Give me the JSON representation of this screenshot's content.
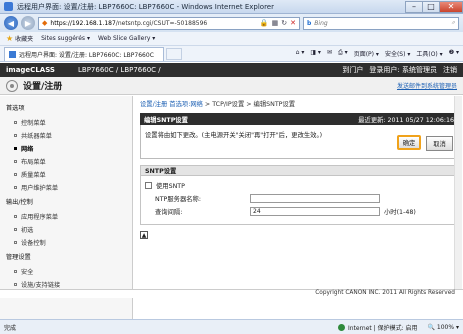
{
  "window": {
    "title": "远程用户界面: 设置/注册: LBP7660C: LBP7660C - Windows Internet Explorer",
    "minimize": "–",
    "maximize": "□",
    "close": "✕"
  },
  "address": {
    "url_host": "https://192.168.1.187",
    "url_path": "/netsntp.cgi/CSUT=-50188596",
    "search_engine": "Bing",
    "search_placeholder": "Bing",
    "back_icon": "◀",
    "forward_icon": "▶"
  },
  "favorites": {
    "label": "收藏夹",
    "items": [
      "Sites suggérés ▾",
      "Web Slice Gallery ▾"
    ]
  },
  "tab": {
    "label": "远程用户界面: 设置/注册: LBP7660C: LBP7660C"
  },
  "commands": {
    "page": "页面(P) ▾",
    "safety": "安全(S) ▾",
    "tools": "工具(O) ▾",
    "help": "❷ ▾"
  },
  "header": {
    "brand": "imageCLASS",
    "model": "LBP7660C / LBP7660C /",
    "links": [
      "到门户",
      "登录用户: 系统管理员",
      "注销"
    ],
    "title": "设置/注册",
    "mail_link": "发送邮件到系统管理员"
  },
  "sidebar": {
    "groups": [
      {
        "label": "首选项",
        "items": [
          {
            "label": "控制菜单",
            "active": false
          },
          {
            "label": "共纸器菜单",
            "active": false
          },
          {
            "label": "网络",
            "active": true
          },
          {
            "label": "布局菜单",
            "active": false
          },
          {
            "label": "质量菜单",
            "active": false
          },
          {
            "label": "用户维护菜单",
            "active": false
          }
        ]
      },
      {
        "label": "输出/控制",
        "items": [
          {
            "label": "应用程序菜单",
            "active": false
          },
          {
            "label": "初选",
            "active": false
          },
          {
            "label": "设备控制",
            "active": false
          }
        ]
      },
      {
        "label": "管理设置",
        "items": [
          {
            "label": "安全",
            "active": false
          },
          {
            "label": "设施/支持链接",
            "active": false
          }
        ]
      }
    ]
  },
  "breadcrumb": {
    "link": "设置/注册 首选项:网络",
    "rest": " > TCP/IP设置 > 编辑SNTP设置"
  },
  "panel": {
    "title": "编辑SNTP设置",
    "last_updated": "最近更新: 2011 05/27 12:06:16",
    "message": "设置将由如下更改。(主电源开关\"关闭\"再\"打开\"后，更改生效。)",
    "ok_label": "确定",
    "cancel_label": "取消"
  },
  "sntp": {
    "section_title": "SNTP设置",
    "use_sntp_label": "使用SNTP",
    "use_sntp_checked": false,
    "server_label": "NTP服务器名称:",
    "server_value": "",
    "interval_label": "查询间隔:",
    "interval_value": "24",
    "interval_unit": "小时(1-48)"
  },
  "footer": {
    "copyright": "Copyright CANON INC. 2011 All Rights Reserved"
  },
  "status": {
    "done": "完成",
    "zone": "Internet | 保护模式: 启用",
    "zoom": "100%"
  }
}
